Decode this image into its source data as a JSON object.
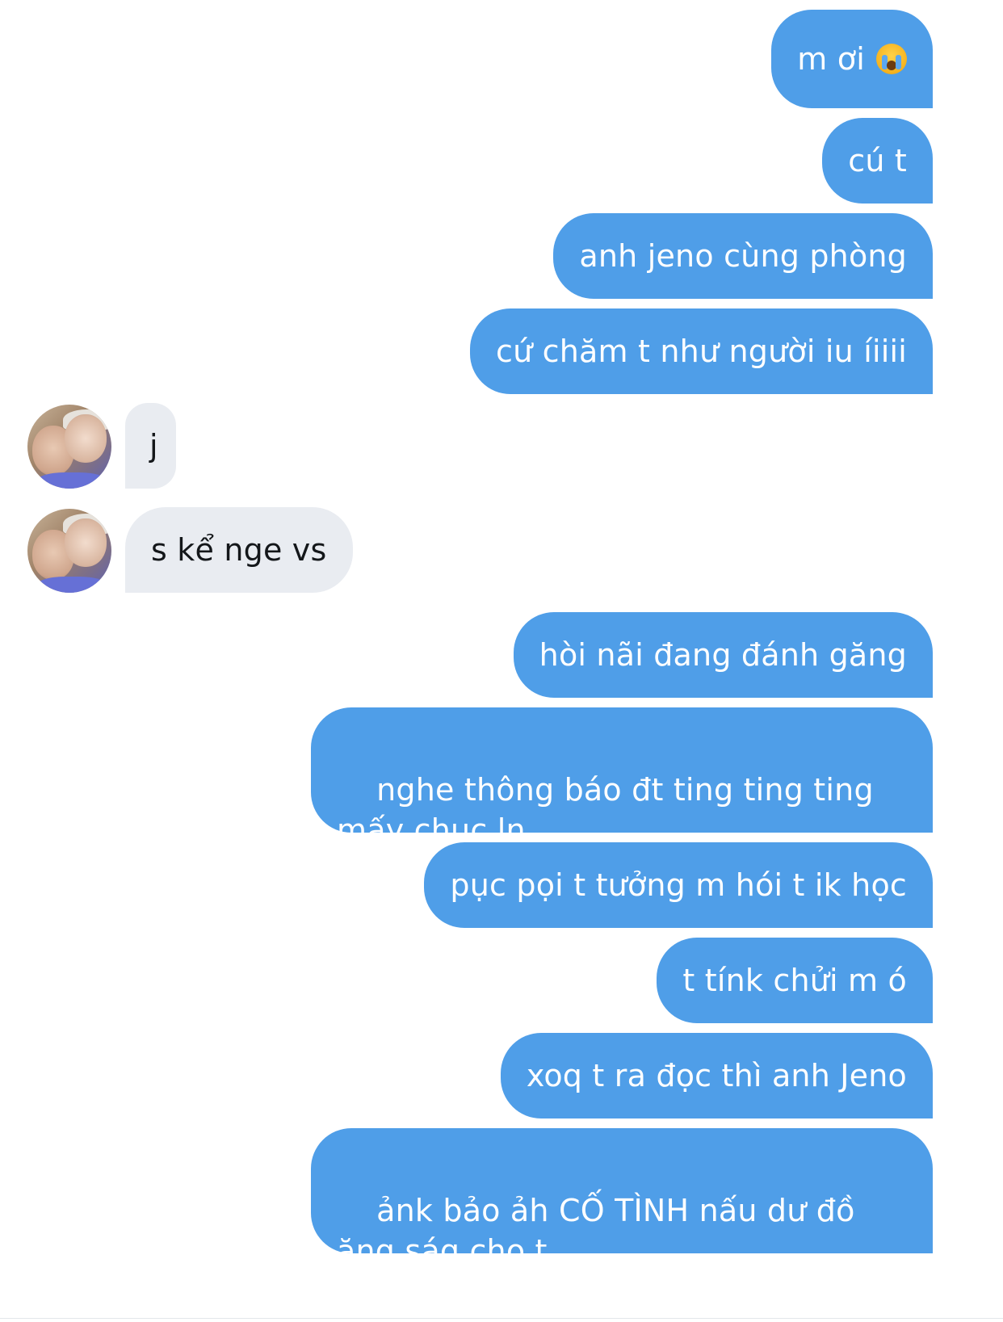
{
  "conversation": {
    "messages": [
      {
        "sender": "me",
        "text": "m ơi",
        "emoji": "loudly-crying-face-emoji"
      },
      {
        "sender": "me",
        "text": "cú t"
      },
      {
        "sender": "me",
        "text": "anh jeno cùng phòng"
      },
      {
        "sender": "me",
        "text": "cứ chăm t như người iu íiiii"
      },
      {
        "sender": "them",
        "text": "j"
      },
      {
        "sender": "them",
        "text": "s kể nge vs"
      },
      {
        "sender": "me",
        "text": "hòi nãi đang đánh găng"
      },
      {
        "sender": "me",
        "text": "nghe thông báo đt ting ting ting mấy chục ln"
      },
      {
        "sender": "me",
        "text": "pục pọi t tưởng m hói t ik học"
      },
      {
        "sender": "me",
        "text": "t tínk chửi m ó"
      },
      {
        "sender": "me",
        "text": "xoq t ra đọc thì anh Jeno"
      },
      {
        "sender": "me",
        "text": "ảnk bảo ảh CỐ TÌNH nấu dư đồ ăng ság cho t"
      }
    ]
  },
  "colors": {
    "sent_bubble": "#4f9ee8",
    "received_bubble": "#e9ecf1",
    "background": "#ffffff"
  }
}
